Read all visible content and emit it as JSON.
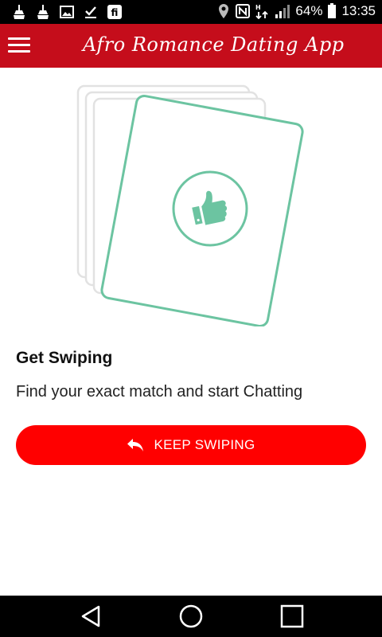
{
  "status_bar": {
    "battery_percent": "64%",
    "time": "13:35",
    "icons": [
      "cleaner-icon",
      "cleaner-icon",
      "image-icon",
      "download-done-icon",
      "fi-app-icon",
      "location-icon",
      "nfc-icon",
      "data-arrows-icon",
      "signal-icon",
      "battery-icon"
    ]
  },
  "app_bar": {
    "menu_icon": "hamburger-menu-icon",
    "title": "Afro Romance Dating App"
  },
  "illustration": {
    "icon": "thumbs-up-icon",
    "accent_color": "#6cc4a1"
  },
  "content": {
    "headline": "Get Swiping",
    "description": "Find your exact match and start Chatting"
  },
  "button": {
    "icon": "reply-arrow-icon",
    "label": "KEEP SWIPING",
    "color": "#ff0000"
  },
  "nav_bar": {
    "items": [
      "back-triangle-icon",
      "home-circle-icon",
      "recents-square-icon"
    ]
  },
  "colors": {
    "app_bar": "#c50d1b",
    "accent": "#6cc4a1"
  }
}
